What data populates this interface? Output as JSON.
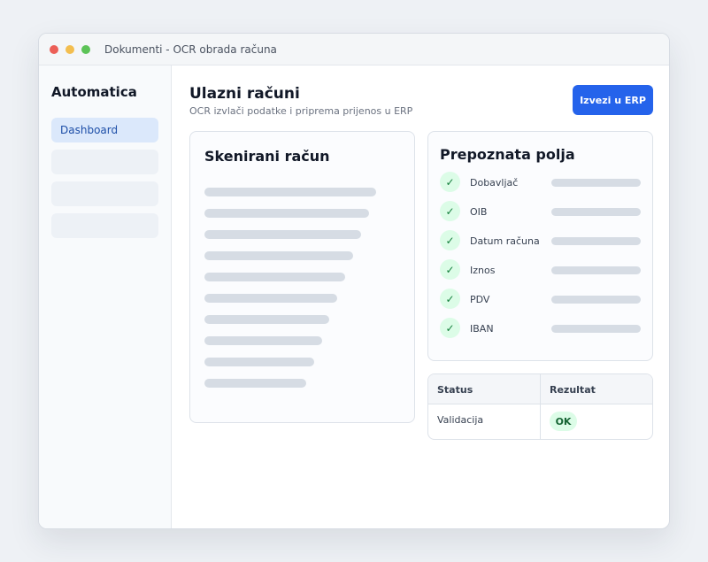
{
  "window": {
    "title": "Dokumenti - OCR obrada računa"
  },
  "sidebar": {
    "brand": "Automatica",
    "items": [
      {
        "label": "Dashboard",
        "active": true
      },
      {
        "label": ""
      },
      {
        "label": ""
      },
      {
        "label": ""
      }
    ]
  },
  "header": {
    "title": "Ulazni računi",
    "subtitle": "OCR izvlači podatke i priprema prijenos u ERP",
    "export_label": "Izvezi u ERP"
  },
  "scan_card": {
    "title": "Skenirani račun"
  },
  "fields_card": {
    "title": "Prepoznata polja",
    "check_glyph": "✓",
    "fields": [
      {
        "label": "Dobavljač"
      },
      {
        "label": "OIB"
      },
      {
        "label": "Datum računa"
      },
      {
        "label": "Iznos"
      },
      {
        "label": "PDV"
      },
      {
        "label": "IBAN"
      }
    ]
  },
  "status_table": {
    "headers": [
      "Status",
      "Rezultat"
    ],
    "rows": [
      {
        "status": "Validacija",
        "result": "OK"
      }
    ]
  },
  "colors": {
    "accent": "#2563eb",
    "success_bg": "#dcfce7",
    "success_text": "#166534"
  }
}
